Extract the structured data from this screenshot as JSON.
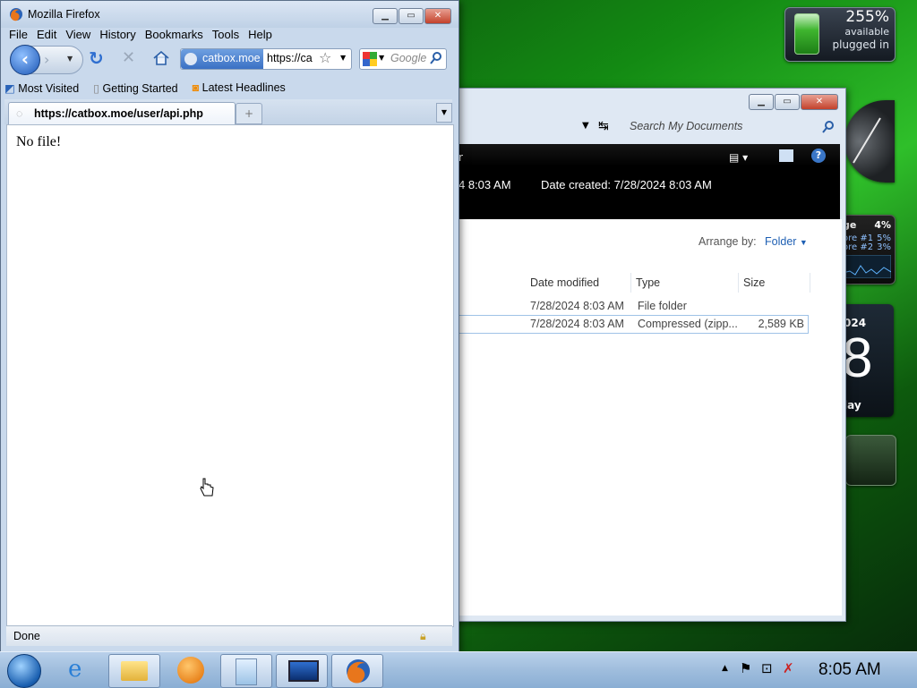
{
  "firefox": {
    "title": "Mozilla Firefox",
    "menus": [
      "File",
      "Edit",
      "View",
      "History",
      "Bookmarks",
      "Tools",
      "Help"
    ],
    "url_site": "catbox.moe",
    "url_text": "https://ca",
    "search_placeholder": "Google",
    "bookmarks": [
      "Most Visited",
      "Getting Started",
      "Latest Headlines"
    ],
    "tab_title": "https://catbox.moe/user/api.php",
    "page_text": "No file!",
    "status": "Done"
  },
  "explorer": {
    "search_placeholder": "Search My Documents",
    "header_fragment": "r",
    "date_fragment": "4 8:03 AM",
    "date_created": "Date created: 7/28/2024 8:03 AM",
    "arrange_label": "Arrange by:",
    "arrange_value": "Folder",
    "columns": [
      "Date modified",
      "Type",
      "Size"
    ],
    "rows": [
      {
        "date": "7/28/2024 8:03 AM",
        "type": "File folder",
        "size": ""
      },
      {
        "date": "7/28/2024 8:03 AM",
        "type": "Compressed (zipp...",
        "size": "2,589 KB"
      }
    ]
  },
  "gadgets": {
    "battery_percent": "255%",
    "battery_available": "available",
    "battery_state": "plugged in",
    "cpu_label": "ge",
    "cpu_total": "4%",
    "cpu_core1_label": "ore #1",
    "cpu_core1": "5%",
    "cpu_core2_label": "ore #2",
    "cpu_core2": "3%",
    "calendar_year": "024",
    "calendar_day": "8",
    "calendar_weekday": "lay"
  },
  "taskbar": {
    "time": "8:05 AM"
  },
  "icons": [
    "firefox-icon",
    "back-icon",
    "forward-icon",
    "reload-icon",
    "stop-icon",
    "home-icon",
    "star-icon",
    "google-icon",
    "search-icon",
    "bookmark-page-icon",
    "rss-icon",
    "new-tab-icon",
    "lock-icon",
    "start-orb-icon",
    "ie-icon",
    "explorer-folder-icon",
    "media-player-icon",
    "documents-icon",
    "remote-desktop-icon",
    "flag-icon",
    "network-icon",
    "volume-muted-icon",
    "help-icon"
  ]
}
